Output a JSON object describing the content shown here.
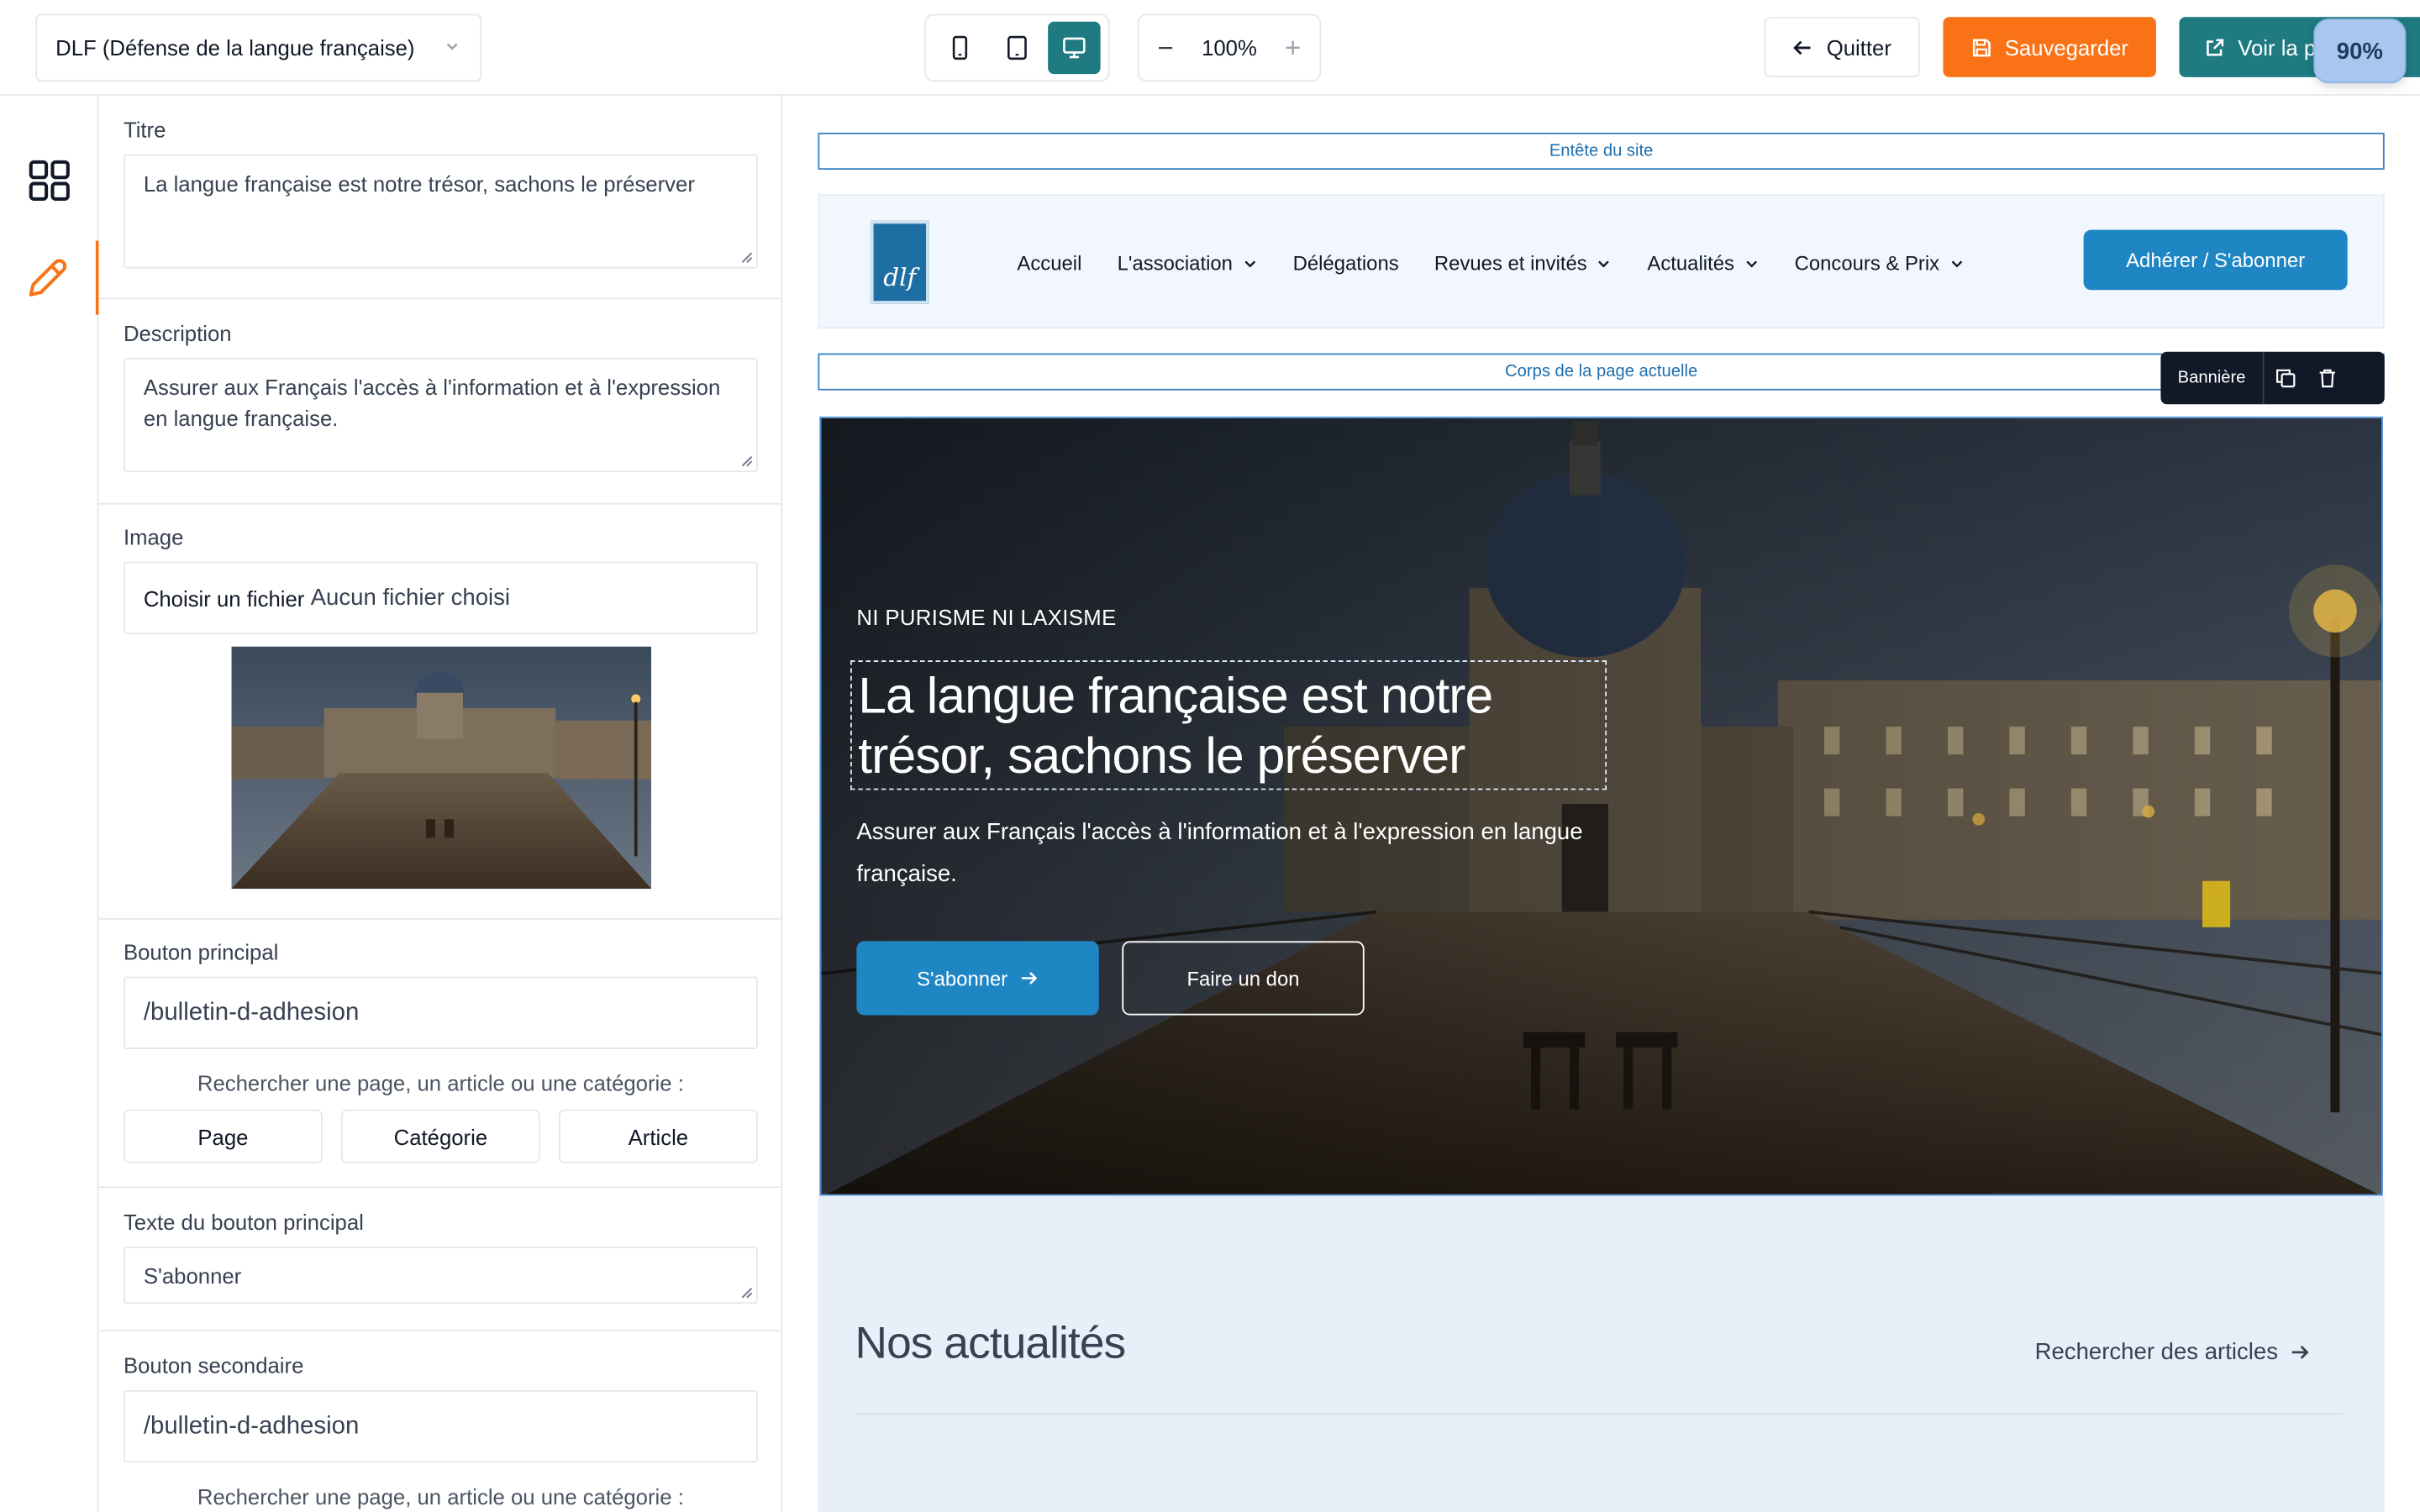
{
  "topbar": {
    "site_selector": "DLF (Défense de la langue française)",
    "zoom_level": "100%",
    "quit_label": "Quitter",
    "save_label": "Sauvegarder",
    "view_label": "Voir la p",
    "zoom_badge": "90%"
  },
  "panel": {
    "title_label": "Titre",
    "title_value": "La langue française est notre trésor, sachons le préserver",
    "description_label": "Description",
    "description_value": "Assurer aux Français l'accès à l'information et à l'expression en langue française.",
    "image_label": "Image",
    "file_button": "Choisir un fichier",
    "file_status": "Aucun fichier choisi",
    "primary_button_label": "Bouton principal",
    "primary_button_value": "/bulletin-d-adhesion",
    "search_hint": "Rechercher une page, un article ou une catégorie :",
    "link_types": [
      "Page",
      "Catégorie",
      "Article"
    ],
    "primary_text_label": "Texte du bouton principal",
    "primary_text_value": "S'abonner",
    "secondary_button_label": "Bouton secondaire",
    "secondary_button_value": "/bulletin-d-adhesion",
    "search_hint_2": "Rechercher une page, un article ou une catégorie :"
  },
  "preview": {
    "header_zone": "Entête du site",
    "body_zone": "Corps de la page actuelle",
    "logo_text": "dlf",
    "nav": [
      "Accueil",
      "L'association",
      "Délégations",
      "Revues et invités",
      "Actualités",
      "Concours & Prix"
    ],
    "cta": "Adhérer / S'abonner",
    "block_toolbar_label": "Bannière",
    "hero": {
      "kicker": "NI PURISME NI LAXISME",
      "title": "La langue française est notre trésor, sachons le préserver",
      "subtitle": "Assurer aux Français l'accès à l'information et à l'expression en langue française.",
      "primary_button": "S'abonner",
      "secondary_button": "Faire un don"
    },
    "news": {
      "title": "Nos actualités",
      "link": "Rechercher des articles"
    }
  },
  "colors": {
    "accent_orange": "#f97316",
    "accent_teal": "#1f7a82",
    "site_blue": "#1f86c4"
  }
}
